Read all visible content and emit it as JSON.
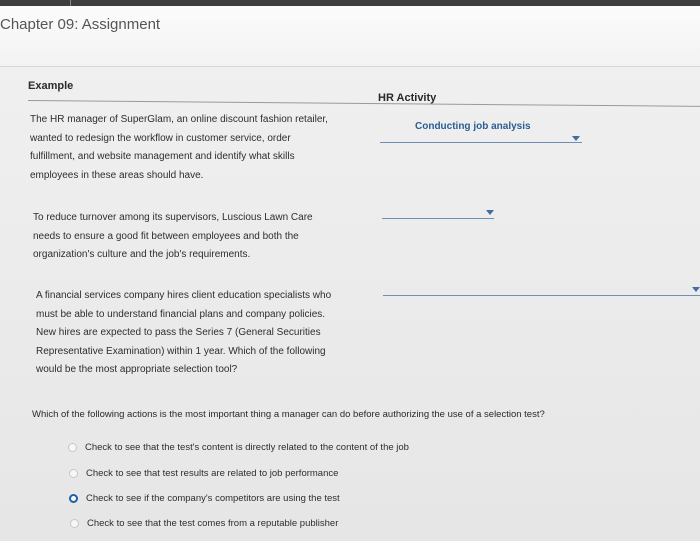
{
  "page": {
    "title": "Chapter 09: Assignment"
  },
  "table": {
    "headers": {
      "example": "Example",
      "hr_activity": "HR Activity"
    },
    "rows": [
      {
        "example_lines": [
          "The HR manager of SuperGlam, an online discount fashion retailer,",
          "wanted to redesign the workflow in customer service, order",
          "fulfillment, and website management and identify what skills",
          "employees in these areas should have."
        ],
        "hr_activity_selected": "Conducting job analysis"
      },
      {
        "example_lines": [
          "To reduce turnover among its supervisors, Luscious Lawn Care",
          "needs to ensure a good fit between employees and both the",
          "organization's culture and the job's requirements."
        ],
        "hr_activity_selected": ""
      },
      {
        "example_lines": [
          "A financial services company hires client education specialists who",
          "must be able to understand financial plans and company policies.",
          "New hires are expected to pass the Series 7 (General Securities",
          "Representative Examination) within 1 year. Which of the following",
          "would be the most appropriate selection tool?"
        ],
        "hr_activity_selected": ""
      }
    ]
  },
  "question": {
    "text": "Which of the following actions is the most important thing a manager can do before authorizing the use of a selection test?",
    "options": [
      {
        "label": "Check to see that the test's content is directly related to the content of the job",
        "selected": false
      },
      {
        "label": "Check to see that test results are related to job performance",
        "selected": false
      },
      {
        "label": "Check to see if the company's competitors are using the test",
        "selected": true
      },
      {
        "label": "Check to see that the test comes from a reputable publisher",
        "selected": false
      }
    ]
  },
  "colors": {
    "accent": "#2a5d95",
    "radio_selected": "#1f5fa3"
  }
}
